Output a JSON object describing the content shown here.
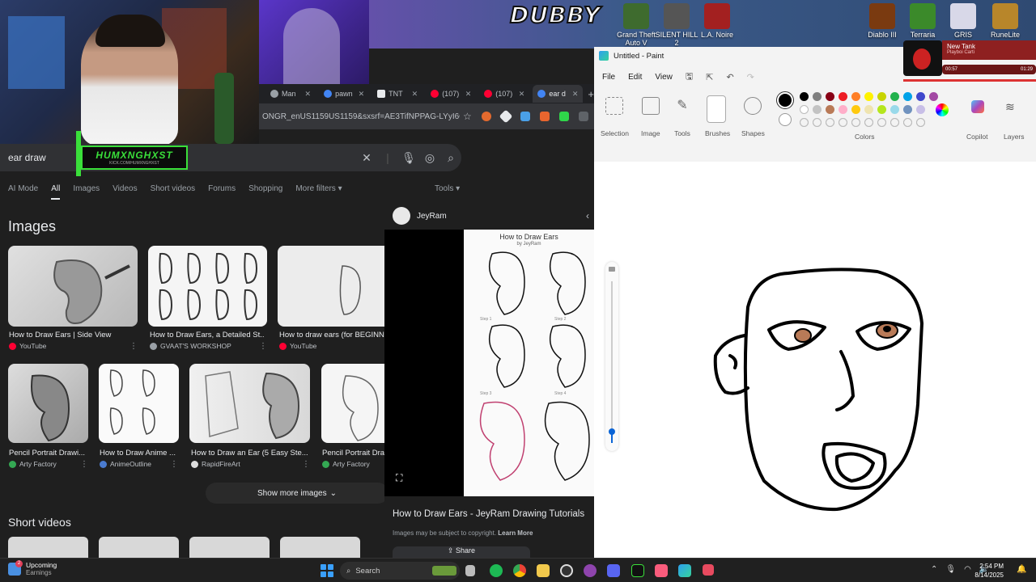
{
  "desktop": {
    "overlay_text": "DUBBY",
    "icons_left": [
      {
        "label": "Grand Theft Auto V",
        "color": "#3e6b2e"
      },
      {
        "label": "SILENT HILL 2",
        "color": "#555555"
      },
      {
        "label": "L.A. Noire",
        "color": "#a32020"
      }
    ],
    "icons_right": [
      {
        "label": "Diablo III",
        "color": "#7a3a10"
      },
      {
        "label": "Terraria",
        "color": "#3b8a2a"
      },
      {
        "label": "GRIS",
        "color": "#d8d8e8"
      },
      {
        "label": "RuneLite",
        "color": "#b8862a"
      }
    ]
  },
  "stream_logo": {
    "name": "HUMXNGHXST",
    "sub": "KICK.COM/HUMXNGHXST"
  },
  "browser": {
    "tabs": [
      {
        "label": "Man",
        "color": "#9aa0a6"
      },
      {
        "label": "pawn",
        "color": "#4285f4"
      },
      {
        "label": "TNT",
        "color": "#e8eaed"
      },
      {
        "label": "(107)",
        "color": "#ff0033"
      },
      {
        "label": "(107)",
        "color": "#ff0033"
      },
      {
        "label": "ear d",
        "color": "#4285f4"
      }
    ],
    "new_tab": "+",
    "url": "ONGR_enUS1159US1159&sxsrf=AE3TifNPPAG-LYyI6GfAz..."
  },
  "google": {
    "query": "ear draw",
    "filters": [
      "AI Mode",
      "All",
      "Images",
      "Videos",
      "Short videos",
      "Forums",
      "Shopping",
      "More filters"
    ],
    "active_filter": "All",
    "tools": "Tools",
    "images_heading": "Images",
    "row1": [
      {
        "caption": "How to Draw Ears | Side View",
        "source": "YouTube",
        "dot": "#ff0033"
      },
      {
        "caption": "How to Draw Ears, a Detailed St...",
        "source": "GVAAT'S WORKSHOP",
        "dot": "#9aa0a6"
      },
      {
        "caption": "How to draw ears (for BEGINNI...",
        "source": "YouTube",
        "dot": "#ff0033"
      }
    ],
    "row2": [
      {
        "caption": "Pencil Portrait Drawi...",
        "source": "Arty Factory",
        "dot": "#34a853"
      },
      {
        "caption": "How to Draw Anime ...",
        "source": "AnimeOutline",
        "dot": "#4a7bd0"
      },
      {
        "caption": "How to Draw an Ear (5 Easy Ste...",
        "source": "RapidFireArt",
        "dot": "#dddddd"
      },
      {
        "caption": "Pencil Portrait Draw...",
        "source": "Arty Factory",
        "dot": "#34a853"
      }
    ],
    "show_more": "Show more images",
    "short_videos_heading": "Short videos"
  },
  "preview": {
    "author": "JeyRam",
    "art_title": "How to Draw Ears",
    "art_by": "by JeyRam",
    "steps": [
      "Step 1",
      "Step 2",
      "Step 3",
      "Step 4"
    ],
    "title": "How to Draw Ears - JeyRam Drawing Tutorials",
    "copyright": "Images may be subject to copyright.",
    "learn_more": "Learn More",
    "share": "Share"
  },
  "paint": {
    "window_title": "Untitled - Paint",
    "menu": [
      "File",
      "Edit",
      "View"
    ],
    "tools": [
      "Selection",
      "Image",
      "Tools",
      "Brushes",
      "Shapes"
    ],
    "colors_label": "Colors",
    "copilot": "Copilot",
    "layers": "Layers",
    "primary_color": "#000000",
    "palette_row1": [
      "#000000",
      "#7f7f7f",
      "#880015",
      "#ed1c24",
      "#ff7f27",
      "#fff200",
      "#c8d400",
      "#22b14c",
      "#00a2e8",
      "#3f48cc",
      "#a349a4"
    ],
    "palette_row2": [
      "#ffffff",
      "#c3c3c3",
      "#b97a57",
      "#ffaec9",
      "#ffc90e",
      "#efe4b0",
      "#b5e61d",
      "#99d9ea",
      "#7092be",
      "#c8bfe7"
    ]
  },
  "music": {
    "song": "New Tank",
    "artist": "Playboi Carti",
    "elapsed": "00:57",
    "total": "01:29"
  },
  "taskbar": {
    "weather_badge": "2",
    "weather_title": "Upcoming",
    "weather_sub": "Earnings",
    "search": "Search",
    "time": "2:54 PM",
    "date": "8/14/2025"
  }
}
